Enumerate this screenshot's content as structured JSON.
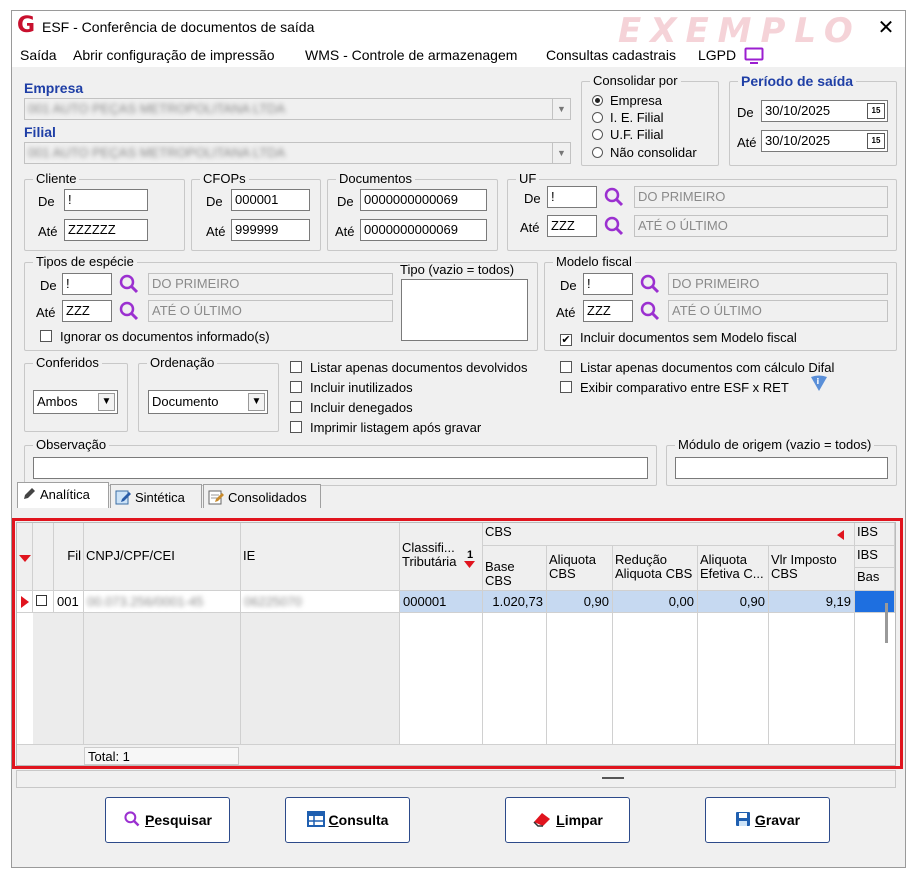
{
  "window": {
    "title": "ESF - Conferência de documentos de saída",
    "watermark": "EXEMPLO",
    "close": "✕"
  },
  "menu": [
    "Saída",
    "Abrir configuração de impressão",
    "WMS - Controle de armazenagem",
    "Consultas cadastrais",
    "LGPD"
  ],
  "empresa": {
    "label": "Empresa",
    "value": "001 AUTO PEÇAS METROPOLITANA LTDA"
  },
  "filial": {
    "label": "Filial",
    "value": "001 AUTO PEÇAS METROPOLITANA LTDA"
  },
  "consolidar": {
    "label": "Consolidar por",
    "options": [
      "Empresa",
      "I. E. Filial",
      "U.F. Filial",
      "Não consolidar"
    ],
    "selected": "Empresa"
  },
  "periodo": {
    "label": "Período de saída",
    "de_label": "De",
    "de": "30/10/2025",
    "ate_label": "Até",
    "ate": "30/10/2025",
    "cal_glyph": "15"
  },
  "cliente": {
    "label": "Cliente",
    "de_label": "De",
    "de": "!",
    "ate_label": "Até",
    "ate": "ZZZZZZ"
  },
  "cfops": {
    "label": "CFOPs",
    "de_label": "De",
    "de": "000001",
    "ate_label": "Até",
    "ate": "999999"
  },
  "documentos": {
    "label": "Documentos",
    "de_label": "De",
    "de": "0000000000069",
    "ate_label": "Até",
    "ate": "0000000000069"
  },
  "uf": {
    "label": "UF",
    "de_label": "De",
    "de": "!",
    "de_desc": "DO PRIMEIRO",
    "ate_label": "Até",
    "ate": "ZZZ",
    "ate_desc": "ATÉ O ÚLTIMO"
  },
  "tipos_especie": {
    "label": "Tipos de espécie",
    "de_label": "De",
    "de": "!",
    "de_desc": "DO PRIMEIRO",
    "ate_label": "Até",
    "ate": "ZZZ",
    "ate_desc": "ATÉ O ÚLTIMO",
    "ignorar": "Ignorar os documentos informado(s)"
  },
  "tipo_vazio": {
    "label": "Tipo (vazio = todos)"
  },
  "modelo_fiscal": {
    "label": "Modelo fiscal",
    "de_label": "De",
    "de": "!",
    "de_desc": "DO PRIMEIRO",
    "ate_label": "Até",
    "ate": "ZZZ",
    "ate_desc": "ATÉ O ÚLTIMO",
    "incluir": "Incluir documentos sem Modelo fiscal"
  },
  "conferidos": {
    "label": "Conferidos",
    "value": "Ambos"
  },
  "ordenacao": {
    "label": "Ordenação",
    "value": "Documento"
  },
  "options_left": [
    "Listar apenas documentos devolvidos",
    "Incluir inutilizados",
    "Incluir denegados",
    "Imprimir listagem após gravar"
  ],
  "options_right": [
    "Listar apenas documentos com cálculo Difal",
    "Exibir comparativo entre ESF x  RET"
  ],
  "observacao": {
    "label": "Observação"
  },
  "modulo": {
    "label": "Módulo de origem (vazio = todos)"
  },
  "tabs": [
    "Analítica",
    "Sintética",
    "Consolidados"
  ],
  "grid": {
    "headers": {
      "fil": "Fil",
      "cnpj": "CNPJ/CPF/CEI",
      "ie": "IE",
      "classif": "Classifi... Tributária",
      "sort_num": "1",
      "cbs_group": "CBS",
      "ibs_group": "IBS",
      "base_cbs": "Base CBS",
      "aliq_cbs": "Aliquota CBS",
      "red_aliq": "Redução Aliquota CBS",
      "aliq_efet": "Aliquota Efetiva C...",
      "vlr_imp": "Vlr Imposto CBS",
      "ibs_sub": "IBS",
      "bas": "Bas"
    },
    "row": {
      "fil": "001",
      "cnpj": "00.073.256/0001-45",
      "ie": "06225070",
      "classif": "000001",
      "base_cbs": "1.020,73",
      "aliq_cbs": "0,90",
      "red_aliq": "0,00",
      "aliq_efet": "0,90",
      "vlr_imp": "9,19"
    },
    "total": "Total: 1"
  },
  "buttons": [
    {
      "key": "P",
      "rest": "esquisar",
      "icon": "search-icon"
    },
    {
      "key": "C",
      "rest": "onsulta",
      "icon": "grid-icon"
    },
    {
      "key": "L",
      "rest": "impar",
      "icon": "eraser-icon"
    },
    {
      "key": "G",
      "rest": "ravar",
      "icon": "save-icon"
    }
  ]
}
